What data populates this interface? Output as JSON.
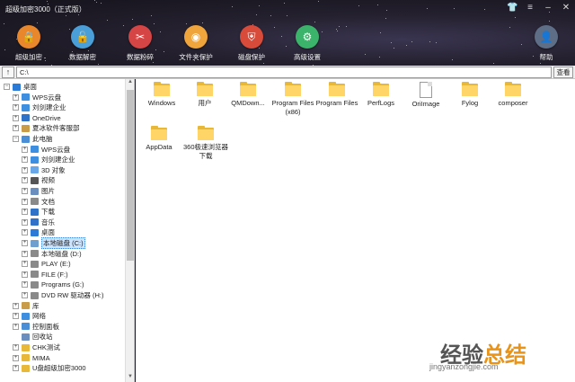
{
  "window": {
    "title": "超级加密3000（正式版）"
  },
  "title_buttons": [
    "shirt-icon",
    "menu-icon",
    "minimize-icon",
    "close-icon"
  ],
  "toolbar": [
    {
      "label": "超级加密",
      "icon": "lock-icon",
      "color": "#e8872b"
    },
    {
      "label": "数据解密",
      "icon": "unlock-icon",
      "color": "#4a9fd8"
    },
    {
      "label": "数据粉碎",
      "icon": "scissors-icon",
      "color": "#d64545"
    },
    {
      "label": "文件夹保护",
      "icon": "palette-icon",
      "color": "#f0a43c"
    },
    {
      "label": "磁盘保护",
      "icon": "shield-icon",
      "color": "#d84a3a"
    },
    {
      "label": "高级设置",
      "icon": "gear-icon",
      "color": "#3bb36b"
    },
    {
      "label": "帮助",
      "icon": "user-icon",
      "color": "#5d6e86"
    }
  ],
  "path": {
    "value": "C:\\",
    "view_label": "查看"
  },
  "tree": [
    {
      "label": "桌面",
      "level": 0,
      "exp": "−",
      "icon": "desktop-icon",
      "color": "#2b7ad6"
    },
    {
      "label": "WPS云盘",
      "level": 1,
      "exp": "+",
      "icon": "cloud-icon",
      "color": "#3f8fe0"
    },
    {
      "label": "刘剑建企业",
      "level": 1,
      "exp": "+",
      "icon": "cloud-icon",
      "color": "#3f8fe0"
    },
    {
      "label": "OneDrive",
      "level": 1,
      "exp": "+",
      "icon": "cloud-icon",
      "color": "#2f72c8"
    },
    {
      "label": "夏冰软件客服部",
      "level": 1,
      "exp": "+",
      "icon": "user-icon",
      "color": "#c99c4a"
    },
    {
      "label": "此电脑",
      "level": 1,
      "exp": "−",
      "icon": "computer-icon",
      "color": "#4a8fd6"
    },
    {
      "label": "WPS云盘",
      "level": 2,
      "exp": "+",
      "icon": "cloud-icon",
      "color": "#3f8fe0"
    },
    {
      "label": "刘剑建企业",
      "level": 2,
      "exp": "+",
      "icon": "cloud-icon",
      "color": "#3f8fe0"
    },
    {
      "label": "3D 对象",
      "level": 2,
      "exp": "+",
      "icon": "cube-icon",
      "color": "#6aa7e8"
    },
    {
      "label": "视频",
      "level": 2,
      "exp": "+",
      "icon": "video-icon",
      "color": "#555"
    },
    {
      "label": "图片",
      "level": 2,
      "exp": "+",
      "icon": "image-icon",
      "color": "#6a8fbf"
    },
    {
      "label": "文档",
      "level": 2,
      "exp": "+",
      "icon": "document-icon",
      "color": "#8a8a8a"
    },
    {
      "label": "下载",
      "level": 2,
      "exp": "+",
      "icon": "download-icon",
      "color": "#2f72c8"
    },
    {
      "label": "音乐",
      "level": 2,
      "exp": "+",
      "icon": "music-icon",
      "color": "#2f72c8"
    },
    {
      "label": "桌面",
      "level": 2,
      "exp": "+",
      "icon": "desktop-icon",
      "color": "#2b7ad6"
    },
    {
      "label": "本地磁盘 (C:)",
      "level": 2,
      "exp": "+",
      "icon": "drive-icon",
      "color": "#6e9fcf",
      "selected": true
    },
    {
      "label": "本地磁盘 (D:)",
      "level": 2,
      "exp": "+",
      "icon": "drive-icon",
      "color": "#8a8a8a"
    },
    {
      "label": "PLAY (E:)",
      "level": 2,
      "exp": "+",
      "icon": "drive-icon",
      "color": "#8a8a8a"
    },
    {
      "label": "FILE (F:)",
      "level": 2,
      "exp": "+",
      "icon": "drive-icon",
      "color": "#8a8a8a"
    },
    {
      "label": "Programs (G:)",
      "level": 2,
      "exp": "+",
      "icon": "drive-icon",
      "color": "#8a8a8a"
    },
    {
      "label": "DVD RW 驱动器 (H:)",
      "level": 2,
      "exp": "+",
      "icon": "dvd-icon",
      "color": "#8a8a8a"
    },
    {
      "label": "库",
      "level": 1,
      "exp": "+",
      "icon": "library-icon",
      "color": "#c99c4a"
    },
    {
      "label": "网络",
      "level": 1,
      "exp": "+",
      "icon": "network-icon",
      "color": "#3f8fe0"
    },
    {
      "label": "控制面板",
      "level": 1,
      "exp": "+",
      "icon": "control-panel-icon",
      "color": "#4a8fd6"
    },
    {
      "label": "回收站",
      "level": 1,
      "exp": "",
      "icon": "recycle-bin-icon",
      "color": "#6a8fbf"
    },
    {
      "label": "CHK测试",
      "level": 1,
      "exp": "+",
      "icon": "folder-icon",
      "color": "#e8b83b"
    },
    {
      "label": "MIMA",
      "level": 1,
      "exp": "+",
      "icon": "folder-icon",
      "color": "#e8b83b"
    },
    {
      "label": "U盘超级加密3000",
      "level": 1,
      "exp": "+",
      "icon": "folder-icon",
      "color": "#e8b83b"
    }
  ],
  "files": [
    {
      "name": "Windows",
      "type": "folder"
    },
    {
      "name": "用户",
      "type": "folder",
      "badge": "🔒"
    },
    {
      "name": "QMDown...",
      "type": "folder"
    },
    {
      "name": "Program Files (x86)",
      "type": "folder"
    },
    {
      "name": "Program Files",
      "type": "folder"
    },
    {
      "name": "PerfLogs",
      "type": "folder"
    },
    {
      "name": "OriImage",
      "type": "file"
    },
    {
      "name": "Fylog",
      "type": "folder"
    },
    {
      "name": "composer",
      "type": "folder"
    },
    {
      "name": "AppData",
      "type": "folder"
    },
    {
      "name": "360极速浏览器下载",
      "type": "folder"
    }
  ],
  "watermark": {
    "text_main": "经验",
    "text_accent": "总结",
    "url": "jingyanzongjie.com"
  }
}
